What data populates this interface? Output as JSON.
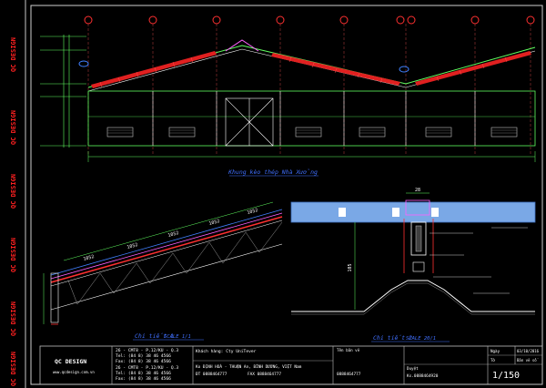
{
  "sidebar": {
    "brand_vertical": "QC DESIGN"
  },
  "drawing": {
    "main_elevation_caption": "Khung kèo thép Nhà Xưởng",
    "detail1": {
      "caption": "Chi tiết 1",
      "scale": "SCALE 1/1",
      "dims": [
        "1052",
        "1052",
        "1052",
        "1052",
        "1052"
      ]
    },
    "detail2": {
      "caption": "Chi tiết 2",
      "scale": "SCALE 20/1",
      "width_dim": "28",
      "height_dim": "105"
    }
  },
  "title_block": {
    "logo": "QC DESIGN",
    "website": "www.qcdesign.com.vn",
    "office_lines": [
      "26 - CMT8 - P.12/KU - Q.3",
      "Tel:   (84 8)  38 46 4566",
      "Fax:   (84 8)  38 46 4566",
      "26 - CMT8 - P.12/KU - Q.3",
      "Tel:   (84 8)  38 46 4566",
      "Fax:   (84 8)  38 46 4566"
    ],
    "project_label": "Khách hàng: Cty UniTever",
    "address": "Ko ĐỊNH HOÀ - THUẬN An, BÌNH DƯƠNG, VIỆT Nam",
    "phone": "ĐT 0888464777",
    "fax": "FAX 0888464777",
    "drawing_name_label": "Tên bản vẽ",
    "contact": "0888464777",
    "designer_label": "Duyệt",
    "designer_value": "Ks.0888464920",
    "date_label": "Ngày",
    "date_value": "03/10/2016",
    "sheet_label": "Tờ",
    "sheet_value": "Bản vẽ số",
    "scale_value": "1/150"
  }
}
